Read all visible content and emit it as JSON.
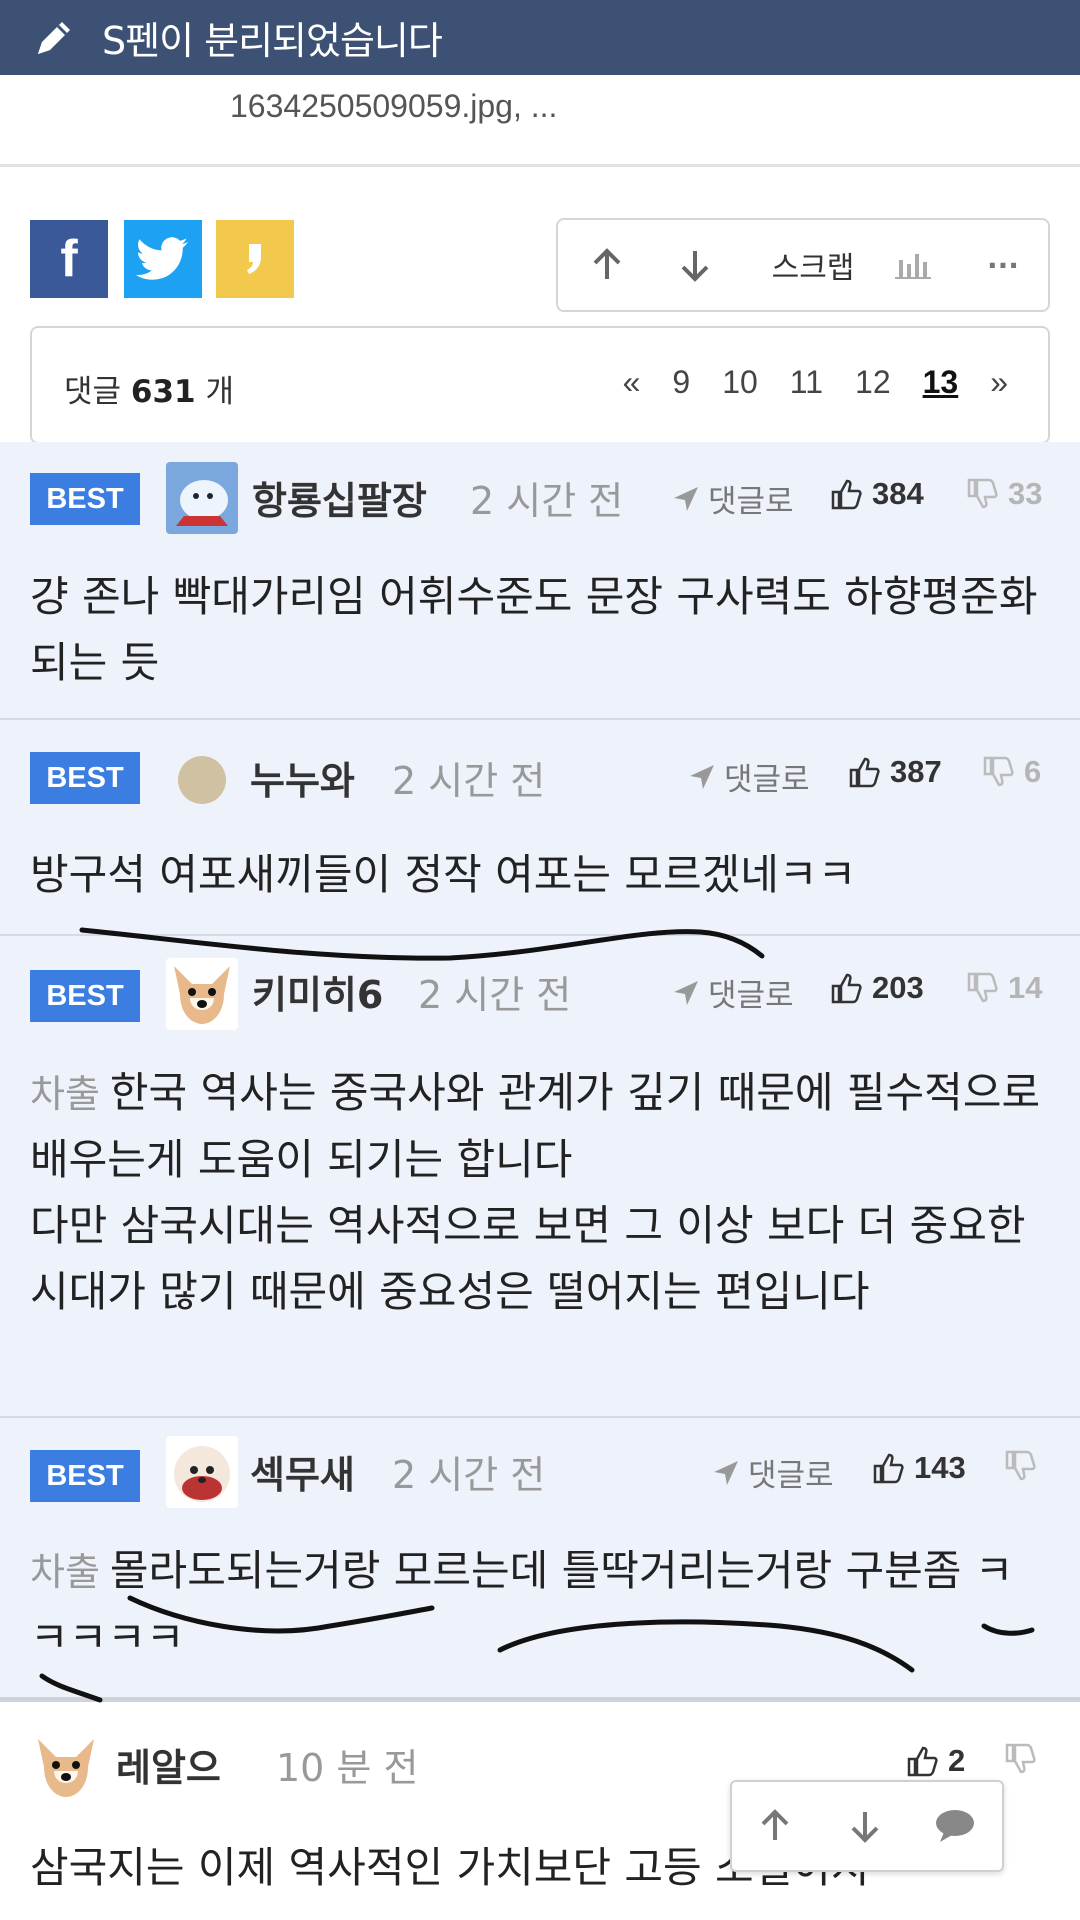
{
  "topbar": {
    "title": "S펜이 분리되었습니다",
    "icon": "pen-icon"
  },
  "attachment": {
    "text": "1634250509059.jpg,   ..."
  },
  "share": {
    "facebook": "f",
    "twitter": "twitter-bird-icon",
    "kakao": "kakao-icon"
  },
  "actions": {
    "scrap_label": "스크랩",
    "more_label": "···"
  },
  "comment_count": {
    "label": "댓글",
    "count": "631",
    "unit": "개"
  },
  "pager": {
    "prev": "«",
    "pages": [
      "9",
      "10",
      "11",
      "12",
      "13"
    ],
    "current": "13",
    "next": "»"
  },
  "comments": [
    {
      "badge": "BEST",
      "author": "항룡십팔장",
      "time": "2 시간 전",
      "reply_label": "댓글로",
      "likes": "384",
      "dislikes": "33",
      "text": "걍 존나 빡대가리임 어휘수준도 문장 구사력도 하향평준화되는 듯"
    },
    {
      "badge": "BEST",
      "author": "누누와",
      "time": "2 시간 전",
      "reply_label": "댓글로",
      "likes": "387",
      "dislikes": "6",
      "text": "방구석 여포새끼들이 정작 여포는 모르겠네ㅋㅋ"
    },
    {
      "badge": "BEST",
      "author": "키미히6",
      "time": "2 시간 전",
      "reply_label": "댓글로",
      "likes": "203",
      "dislikes": "14",
      "prefix": "차출",
      "text": "한국 역사는 중국사와 관계가 깊기 때문에 필수적으로 배우는게 도움이 되기는 합니다",
      "text2": "다만 삼국시대는 역사적으로 보면 그 이상 보다 더 중요한 시대가 많기 때문에 중요성은 떨어지는 편입니다"
    },
    {
      "badge": "BEST",
      "author": "섹무새",
      "time": "2 시간 전",
      "reply_label": "댓글로",
      "likes": "143",
      "dislikes": "",
      "prefix": "차출",
      "text": "몰라도되는거랑 모르는데 틀딱거리는거랑 구분좀 ㅋㅋㅋㅋㅋ"
    },
    {
      "author": "레알으",
      "time": "10 분 전",
      "likes": "2",
      "text": "삼국지는 이제 역사적인 가치보단 고등 소설이지"
    }
  ],
  "colors": {
    "topbar": "#3d5174",
    "best_badge": "#3b7de0",
    "best_bg": "#eef2fb"
  }
}
